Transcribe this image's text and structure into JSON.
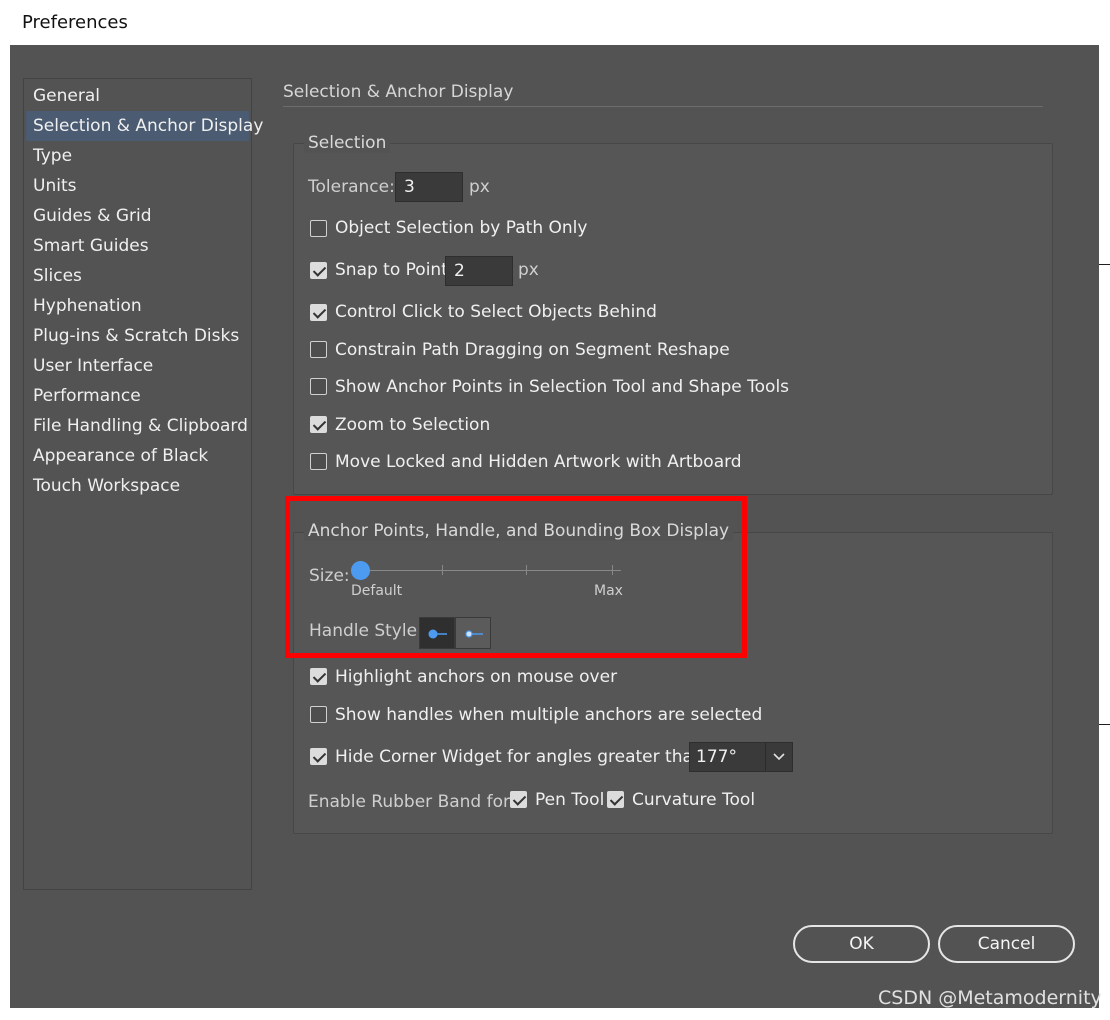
{
  "window": {
    "title": "Preferences"
  },
  "sidebar": {
    "items": [
      {
        "label": "General"
      },
      {
        "label": "Selection & Anchor Display"
      },
      {
        "label": "Type"
      },
      {
        "label": "Units"
      },
      {
        "label": "Guides & Grid"
      },
      {
        "label": "Smart Guides"
      },
      {
        "label": "Slices"
      },
      {
        "label": "Hyphenation"
      },
      {
        "label": "Plug-ins & Scratch Disks"
      },
      {
        "label": "User Interface"
      },
      {
        "label": "Performance"
      },
      {
        "label": "File Handling & Clipboard"
      },
      {
        "label": "Appearance of Black"
      },
      {
        "label": "Touch Workspace"
      }
    ],
    "selected_index": 1
  },
  "page": {
    "title": "Selection & Anchor Display"
  },
  "selection": {
    "group_label": "Selection",
    "tolerance_label": "Tolerance:",
    "tolerance_value": "3",
    "tolerance_unit": "px",
    "object_selection_by_path_only": {
      "label": "Object Selection by Path Only",
      "checked": false
    },
    "snap_to_point": {
      "label": "Snap to Point",
      "checked": true,
      "value": "2",
      "unit": "px"
    },
    "control_click": {
      "label": "Control Click to Select Objects Behind",
      "checked": true
    },
    "constrain_path": {
      "label": "Constrain Path Dragging on Segment Reshape",
      "checked": false
    },
    "show_anchor_points": {
      "label": "Show Anchor Points in Selection Tool and Shape Tools",
      "checked": false
    },
    "zoom_to_selection": {
      "label": "Zoom to Selection",
      "checked": true
    },
    "move_locked": {
      "label": "Move Locked and Hidden Artwork with Artboard",
      "checked": false
    }
  },
  "anchor_display": {
    "group_label": "Anchor Points, Handle, and Bounding Box Display",
    "size_label": "Size:",
    "size_min_label": "Default",
    "size_max_label": "Max",
    "size_level": 0,
    "handle_style_label": "Handle Style:",
    "handle_style_selected": 0,
    "highlight_anchors": {
      "label": "Highlight anchors on mouse over",
      "checked": true
    },
    "show_handles_multiple": {
      "label": "Show handles when multiple anchors are selected",
      "checked": false
    },
    "hide_corner_widget": {
      "label": "Hide Corner Widget for angles greater than:",
      "checked": true,
      "value": "177°"
    },
    "rubber_band_label": "Enable Rubber Band for:",
    "pen_tool": {
      "label": "Pen Tool",
      "checked": true
    },
    "curvature_tool": {
      "label": "Curvature Tool",
      "checked": true
    }
  },
  "buttons": {
    "ok": "OK",
    "cancel": "Cancel"
  },
  "watermark": "CSDN @Metamodernity",
  "colors": {
    "accent": "#4d9bf0",
    "highlight": "#ff0000",
    "selected_row": "#4a5b72"
  }
}
